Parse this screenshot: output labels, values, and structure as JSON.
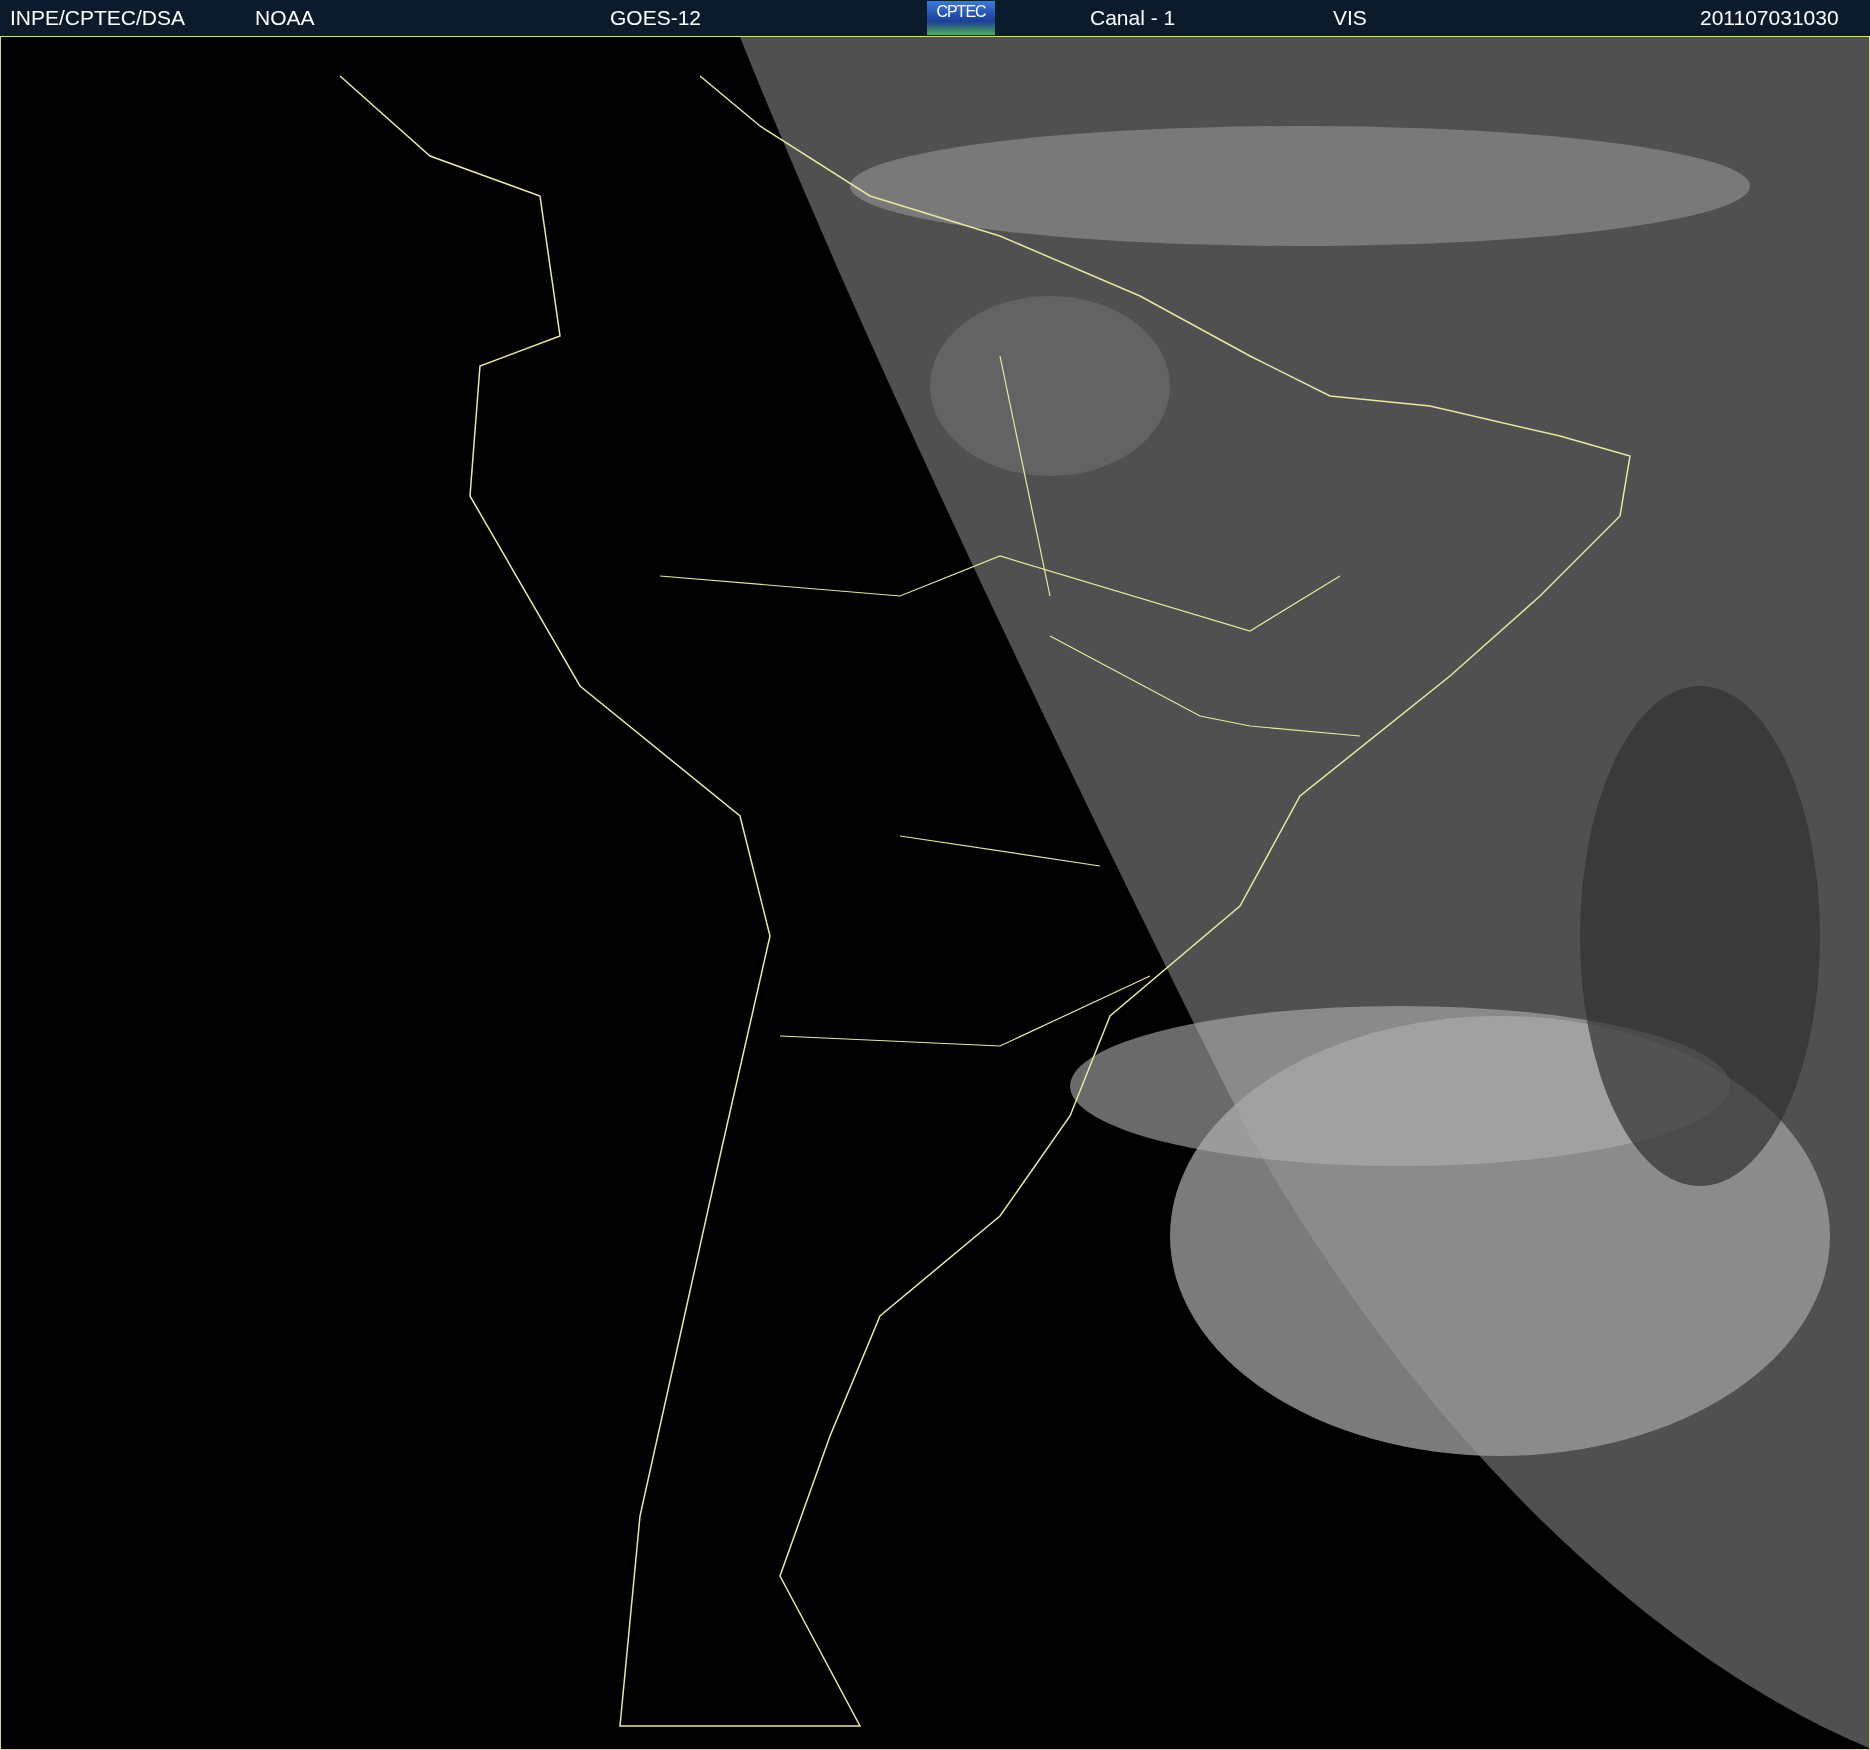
{
  "header": {
    "source": "INPE/CPTEC/DSA",
    "agency": "NOAA",
    "satellite": "GOES-12",
    "logo": "CPTEC",
    "channel": "Canal - 1",
    "band": "VIS",
    "timestamp": "201107031030"
  }
}
